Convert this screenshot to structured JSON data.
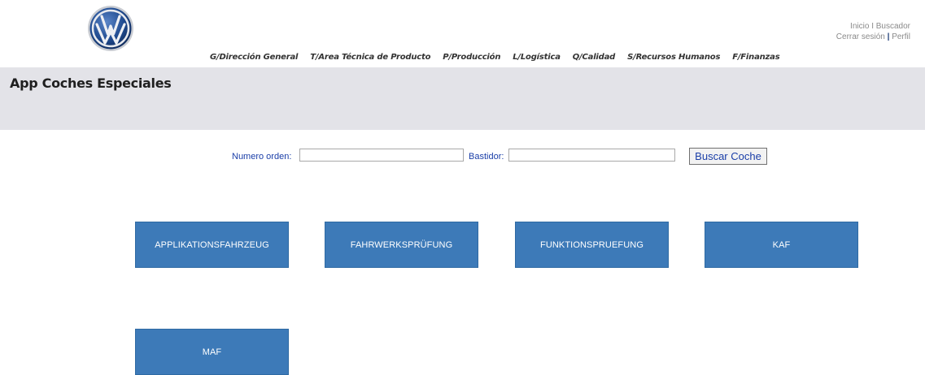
{
  "top_links": {
    "inicio": "Inicio",
    "sep1": "I",
    "buscador": "Buscador",
    "cerrar_sesion": "Cerrar sesión",
    "sep2": "|",
    "perfil": "Perfil"
  },
  "nav": [
    "G/Dirección General",
    "T/Area Técnica de Producto",
    "P/Producción",
    "L/Logística",
    "Q/Calidad",
    "S/Recursos Humanos",
    "F/Finanzas"
  ],
  "app_title": "App Coches Especiales",
  "search": {
    "order_label": "Numero orden:",
    "order_value": "",
    "chassis_label": "Bastidor:",
    "chassis_value": "",
    "button_label": "Buscar Coche"
  },
  "tiles": [
    "APPLIKATIONSFAHRZEUG",
    "FAHRWERKSPRÜFUNG",
    "FUNKTIONSPRUEFUNG",
    "KAF",
    "MAF"
  ],
  "colors": {
    "tile_bg": "#3d7ab8",
    "header_band": "#e3e3e8",
    "label_blue": "#1a3ea8",
    "logo_blue": "#1c3d7a"
  },
  "icons": {
    "logo": "volkswagen-logo-icon"
  }
}
